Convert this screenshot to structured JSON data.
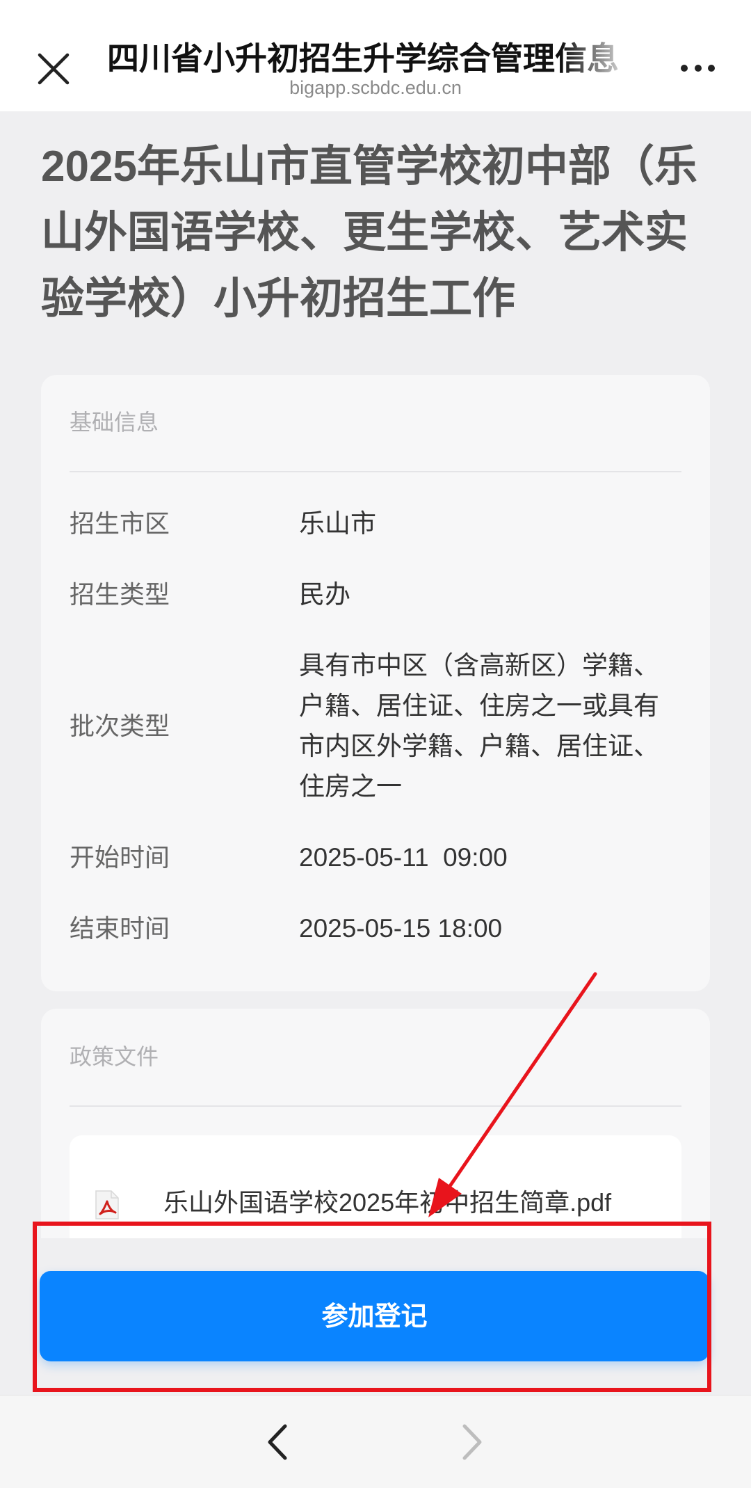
{
  "header": {
    "close_icon": "close-icon",
    "title": "四川省小升初招生升学综合管理信息",
    "url": "bigapp.scbdc.edu.cn",
    "more_icon": "more-icon"
  },
  "page": {
    "title": "2025年乐山市直管学校初中部（乐山外国语学校、更生学校、艺术实验学校）小升初招生工作"
  },
  "basic_info": {
    "heading": "基础信息",
    "rows": [
      {
        "label": "招生市区",
        "value": "乐山市"
      },
      {
        "label": "招生类型",
        "value": "民办"
      },
      {
        "label": "批次类型",
        "value": "具有市中区（含高新区）学籍、户籍、居住证、住房之一或具有市内区外学籍、户籍、居住证、住房之一"
      },
      {
        "label": "开始时间",
        "value": "2025-05-11  09:00"
      },
      {
        "label": "结束时间",
        "value": "2025-05-15 18:00"
      }
    ]
  },
  "policy": {
    "heading": "政策文件",
    "files": [
      {
        "name": "乐山外国语学校2025年初中招生简章.pdf",
        "icon": "pdf-icon"
      }
    ]
  },
  "action": {
    "register_label": "参加登记"
  },
  "nav": {
    "back_icon": "chevron-left-icon",
    "forward_icon": "chevron-right-icon",
    "forward_enabled": false
  },
  "colors": {
    "accent": "#0a84ff",
    "page_background": "#efeff1",
    "annotation": "#e8141c"
  }
}
